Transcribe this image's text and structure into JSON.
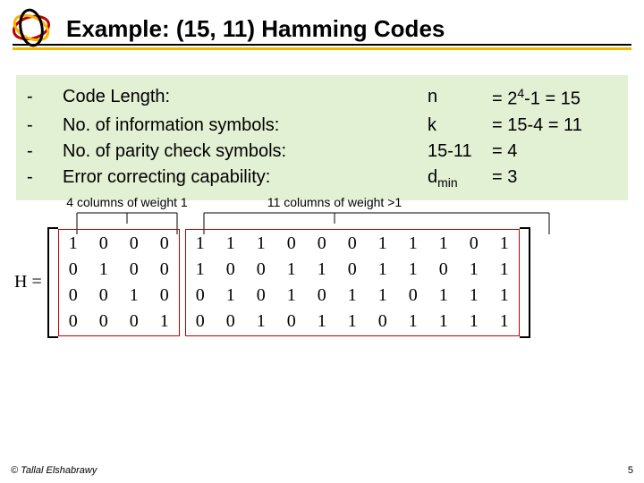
{
  "title": "Example: (15, 11) Hamming Codes",
  "info": {
    "rows": [
      {
        "dash": "-",
        "label": "Code Length:",
        "sym": "n",
        "sub": "",
        "val": "= 2",
        "sup": "4",
        "valtail": "-1 = 15"
      },
      {
        "dash": "-",
        "label": "No. of information symbols:",
        "sym": "k",
        "sub": "",
        "val": "= 15-4 = 11",
        "sup": "",
        "valtail": ""
      },
      {
        "dash": "-",
        "label": "No. of parity check symbols:",
        "sym": "15-11",
        "sub": "",
        "val": "= 4",
        "sup": "",
        "valtail": ""
      },
      {
        "dash": "-",
        "label": "Error correcting capability:",
        "sym": "d",
        "sub": "min",
        "val": "= 3",
        "sup": "",
        "valtail": ""
      }
    ]
  },
  "annotations": {
    "left": "4 columns of weight 1",
    "right": "11 columns of weight >1"
  },
  "matrix": {
    "label": "H =",
    "group1": [
      [
        1,
        0,
        0,
        0
      ],
      [
        0,
        1,
        0,
        0
      ],
      [
        0,
        0,
        1,
        0
      ],
      [
        0,
        0,
        0,
        1
      ]
    ],
    "group2": [
      [
        1,
        1,
        0,
        0
      ],
      [
        1,
        0,
        1,
        0
      ],
      [
        1,
        0,
        0,
        1
      ],
      [
        0,
        1,
        1,
        0
      ],
      [
        0,
        1,
        0,
        1
      ],
      [
        0,
        0,
        1,
        1
      ],
      [
        1,
        1,
        1,
        0
      ],
      [
        1,
        1,
        0,
        1
      ],
      [
        1,
        0,
        1,
        1
      ],
      [
        0,
        1,
        1,
        1
      ],
      [
        1,
        1,
        1,
        1
      ]
    ]
  },
  "footer": {
    "left": "© Tallal Elshabrawy",
    "page": "5"
  }
}
